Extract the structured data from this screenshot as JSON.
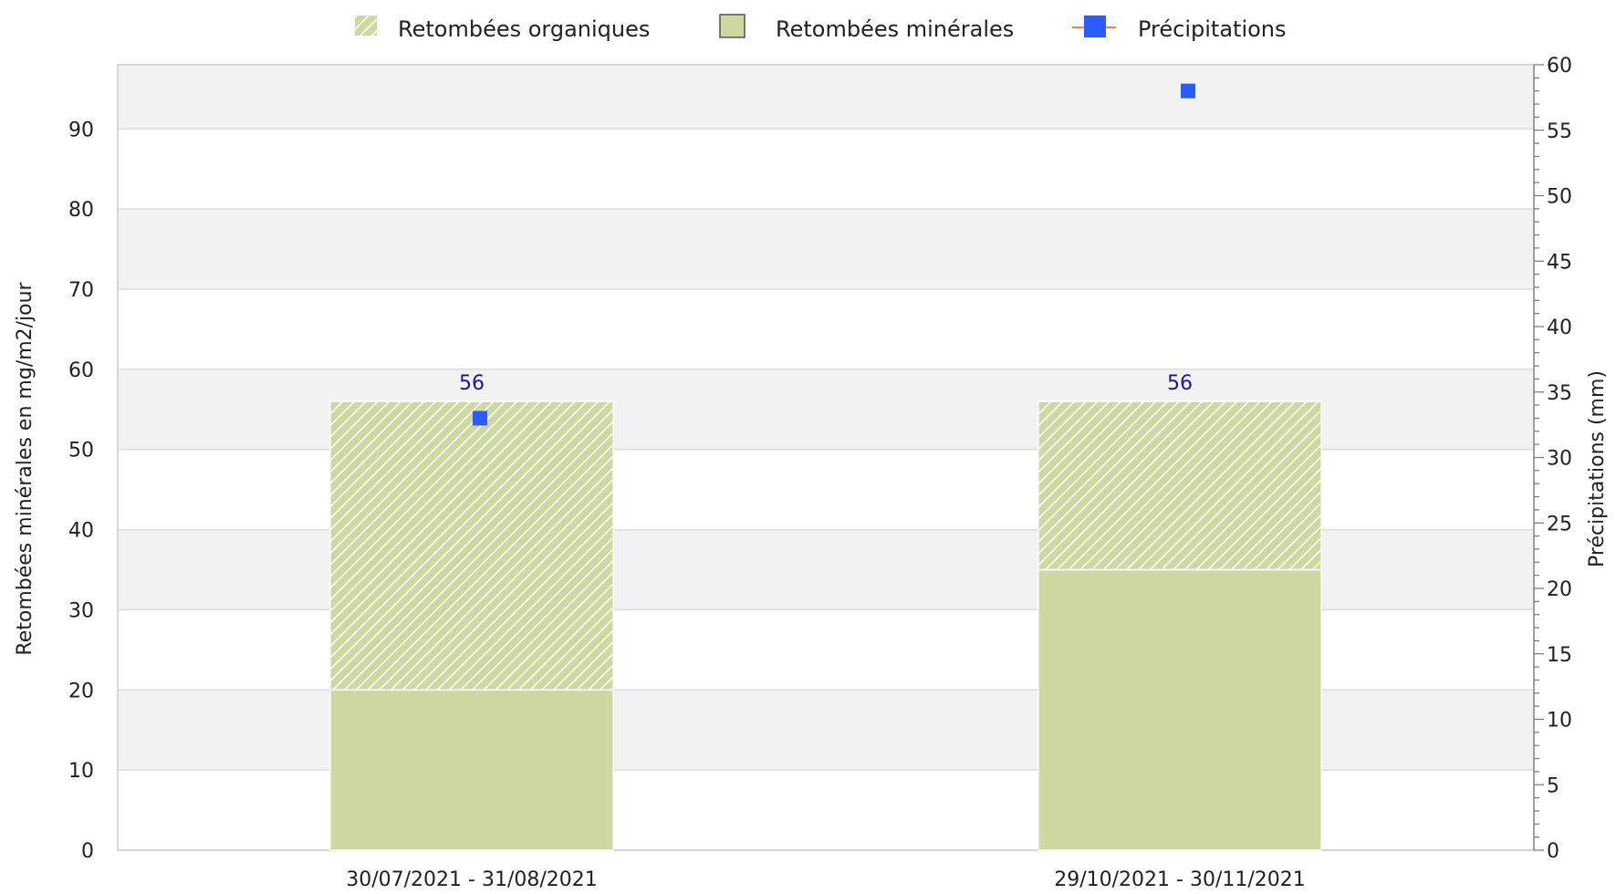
{
  "chart_data": {
    "type": "bar",
    "stacked": true,
    "categories": [
      "30/07/2021 - 31/08/2021",
      "29/10/2021 - 30/11/2021"
    ],
    "series": [
      {
        "name": "Retombées minérales",
        "axis": "left",
        "values": [
          20,
          35
        ],
        "color": "#cdd9a1",
        "pattern": "solid"
      },
      {
        "name": "Retombées organiques",
        "axis": "left",
        "values": [
          36,
          21
        ],
        "color": "#cdd9a1",
        "pattern": "hatched"
      },
      {
        "name": "Précipitations",
        "axis": "right",
        "type": "scatter",
        "values": [
          33,
          58
        ],
        "color": "#2b5cff"
      }
    ],
    "totals": [
      "56",
      "56"
    ],
    "ylabel": "Retombées minérales en mg/m2/jour",
    "ylabel_right": "Précipitations (mm)",
    "ylim": [
      0,
      98
    ],
    "yticks": [
      "0",
      "10",
      "20",
      "30",
      "40",
      "50",
      "60",
      "70",
      "80",
      "90"
    ],
    "ylim_right": [
      0,
      60
    ],
    "yticks_right": [
      "0",
      "5",
      "10",
      "15",
      "20",
      "25",
      "30",
      "35",
      "40",
      "45",
      "50",
      "55",
      "60"
    ],
    "legend": [
      "Retombées organiques",
      "Retombées minérales",
      "Précipitations"
    ],
    "legend_position": "top",
    "grid": true,
    "band_color": "#f2f2f2"
  }
}
